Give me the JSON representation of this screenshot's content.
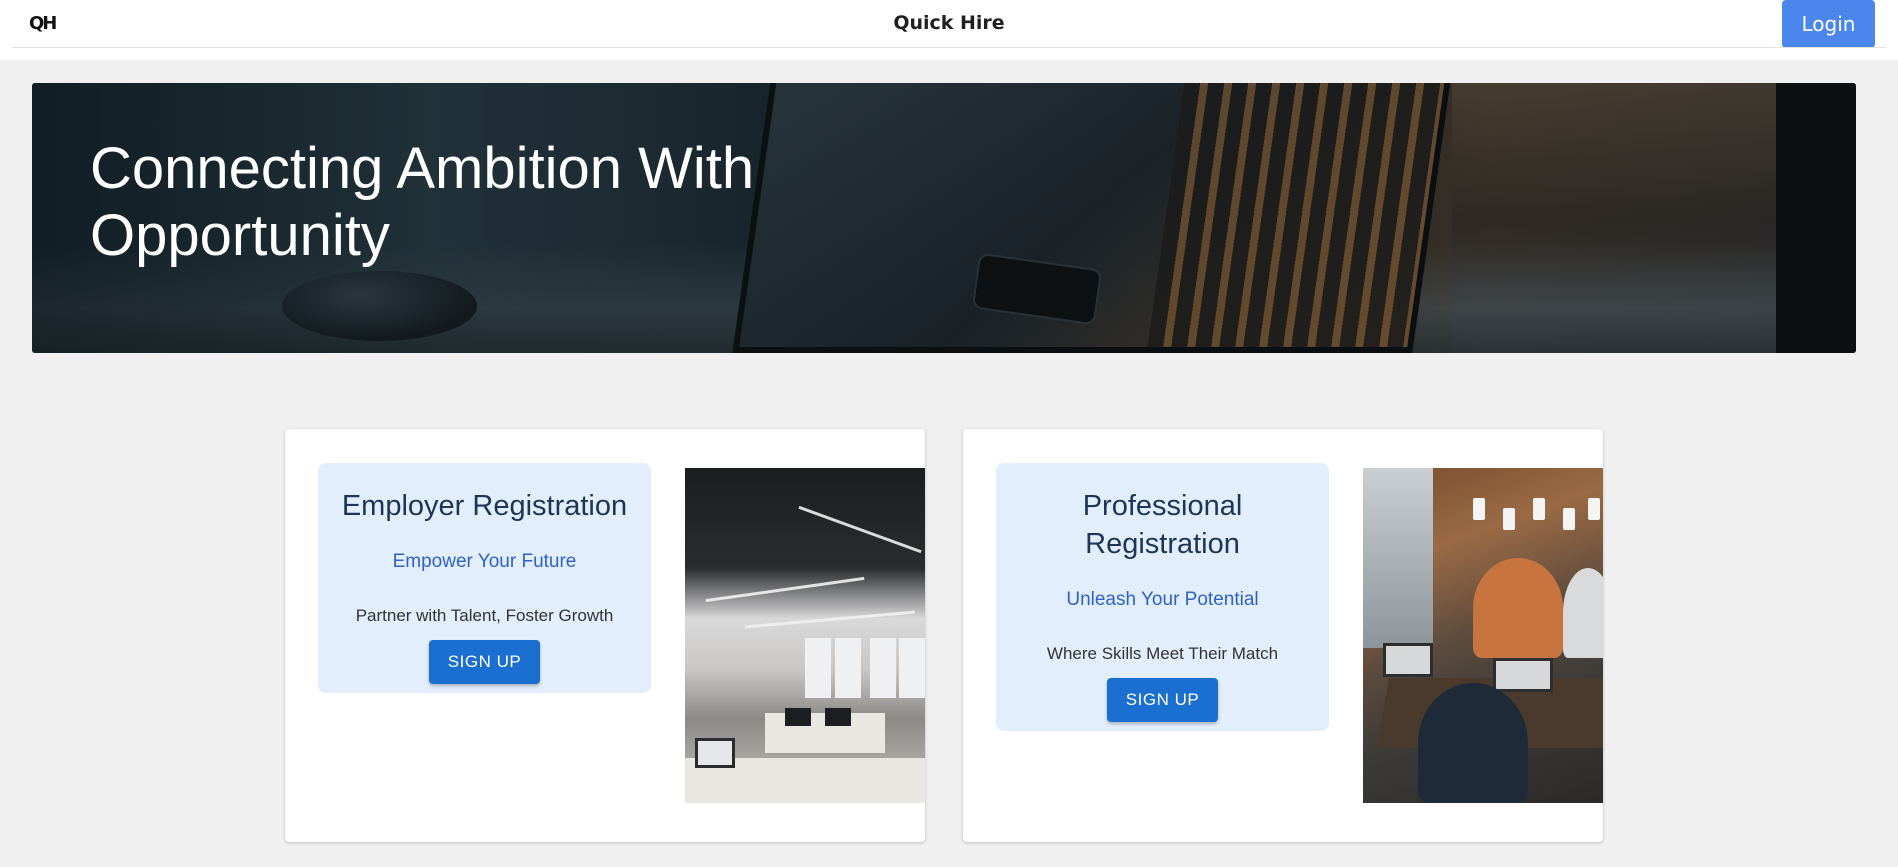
{
  "header": {
    "logo_text": "QH",
    "title": "Quick Hire",
    "login_label": "Login",
    "login_color": "#4a86ec"
  },
  "hero": {
    "heading": "Connecting Ambition With Opportunity"
  },
  "cards": [
    {
      "title": "Employer Registration",
      "subtitle": "Empower Your Future",
      "description": "Partner with Talent, Foster Growth",
      "button_label": "SIGN UP",
      "photo": "office-workspace-photo"
    },
    {
      "title": "Professional Registration",
      "subtitle": "Unleash Your Potential",
      "description": "Where Skills Meet Their Match",
      "button_label": "SIGN UP",
      "photo": "team-working-photo"
    }
  ],
  "colors": {
    "page_background": "#f0f0f0",
    "card_box_background": "#e2eefb",
    "title_color": "#1d3557",
    "subtitle_color": "#2f62c9",
    "signup_button": "#1b6fd0"
  }
}
